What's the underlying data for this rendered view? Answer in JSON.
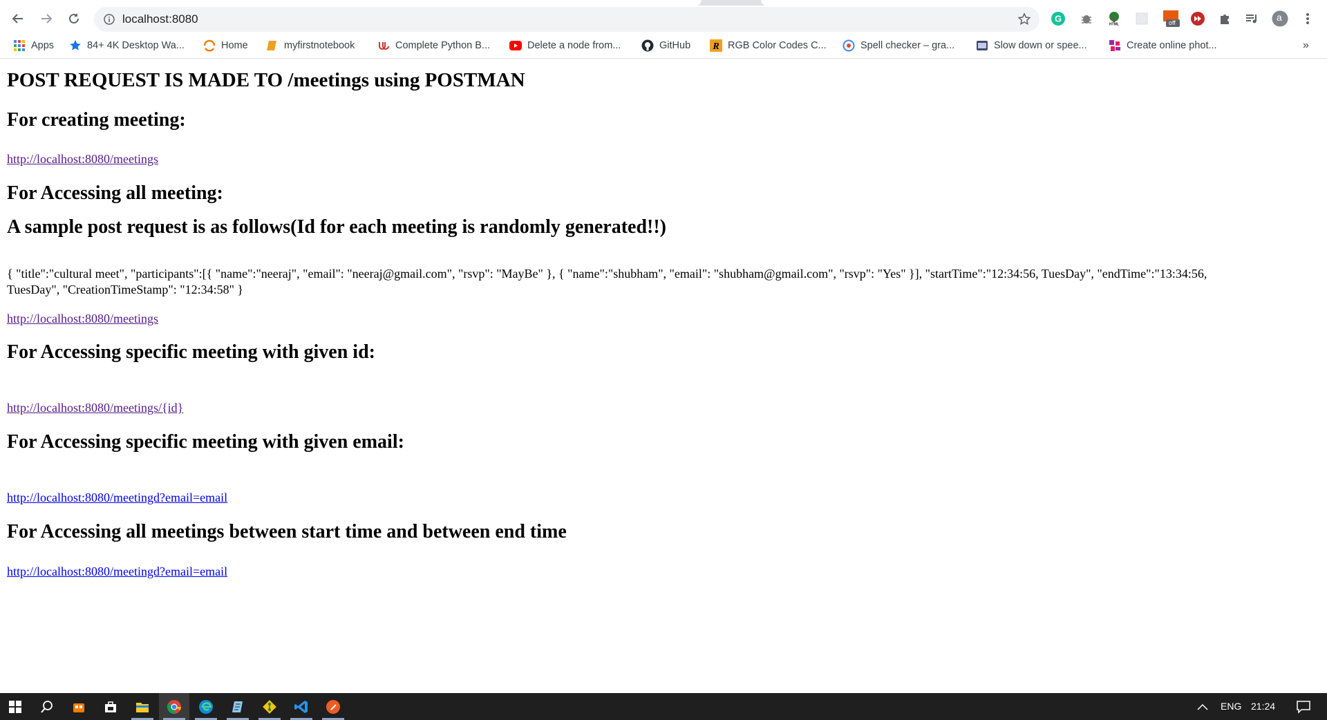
{
  "browser": {
    "address": "localhost:8080",
    "profile_initial": "a",
    "extension_badge": "off",
    "bookmarks": [
      {
        "label": "Apps",
        "icon": "apps-grid-icon"
      },
      {
        "label": "84+ 4K Desktop Wa...",
        "icon": "star-icon"
      },
      {
        "label": "Home",
        "icon": "home-arc-icon"
      },
      {
        "label": "myfirstnotebook",
        "icon": "notebook-icon"
      },
      {
        "label": "Complete Python B...",
        "icon": "udemy-icon"
      },
      {
        "label": "Delete a node from...",
        "icon": "youtube-icon"
      },
      {
        "label": "GitHub",
        "icon": "github-icon"
      },
      {
        "label": "RGB Color Codes C...",
        "icon": "rgb-r-icon"
      },
      {
        "label": "Spell checker – gra...",
        "icon": "spellcheck-icon"
      },
      {
        "label": "Slow down or spee...",
        "icon": "video-speed-icon"
      },
      {
        "label": "Create online phot...",
        "icon": "photo-collage-icon"
      }
    ],
    "overflow": "»"
  },
  "page": {
    "title": "POST REQUEST IS MADE TO /meetings using POSTMAN",
    "create_heading": "For creating meeting:",
    "create_link": "http://localhost:8080/meetings",
    "access_all_heading": "For Accessing all meeting:",
    "sample_heading": "A sample post request is as follows(Id for each meeting is randomly generated!!)",
    "sample_body": "{ \"title\":\"cultural meet\", \"participants\":[{ \"name\":\"neeraj\", \"email\": \"neeraj@gmail.com\", \"rsvp\": \"MayBe\" }, { \"name\":\"shubham\", \"email\": \"shubham@gmail.com\", \"rsvp\": \"Yes\" }], \"startTime\":\"12:34:56, TuesDay\", \"endTime\":\"13:34:56, TuesDay\", \"CreationTimeStamp\": \"12:34:58\" }",
    "access_all_link": "http://localhost:8080/meetings",
    "by_id_heading": "For Accessing specific meeting with given id:",
    "by_id_link": "http://localhost:8080/meetings/{id}",
    "by_email_heading": "For Accessing specific meeting with given email:",
    "by_email_link": "http://localhost:8080/meetingd?email=email",
    "range_heading": "For Accessing all meetings between start time and between end time",
    "range_link": "http://localhost:8080/meetingd?email=email"
  },
  "taskbar": {
    "language": "ENG",
    "clock": "21:24",
    "apps": [
      "start-windows-icon",
      "search-icon",
      "store-bag-icon",
      "briefcase-icon",
      "file-explorer-icon",
      "chrome-icon",
      "edge-icon",
      "notepad-icon",
      "git-icon",
      "vscode-icon",
      "postman-icon"
    ]
  },
  "colors": {
    "link_visited": "#551a8b",
    "link_unvisited": "#0000ee",
    "taskbar_bg": "#1f1f1f",
    "omnibox_bg": "#f1f3f4"
  }
}
